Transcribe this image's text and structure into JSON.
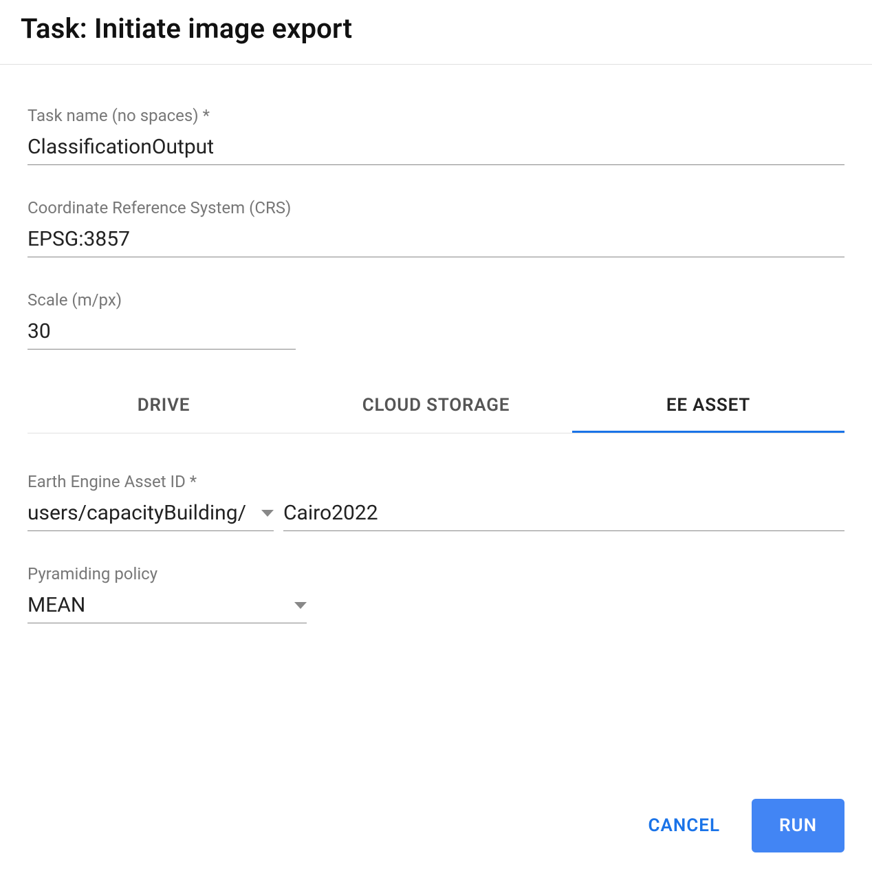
{
  "header": {
    "title": "Task: Initiate image export"
  },
  "fields": {
    "task_name": {
      "label": "Task name (no spaces) *",
      "value": "ClassificationOutput"
    },
    "crs": {
      "label": "Coordinate Reference System (CRS)",
      "value": "EPSG:3857"
    },
    "scale": {
      "label": "Scale (m/px)",
      "value": "30"
    },
    "asset_id": {
      "label": "Earth Engine Asset ID *",
      "path_prefix": "users/capacityBuilding/",
      "value": "Cairo2022"
    },
    "pyramid": {
      "label": "Pyramiding policy",
      "value": "MEAN"
    }
  },
  "tabs": {
    "drive": "DRIVE",
    "cloud_storage": "CLOUD STORAGE",
    "ee_asset": "EE ASSET"
  },
  "actions": {
    "cancel": "CANCEL",
    "run": "RUN"
  }
}
